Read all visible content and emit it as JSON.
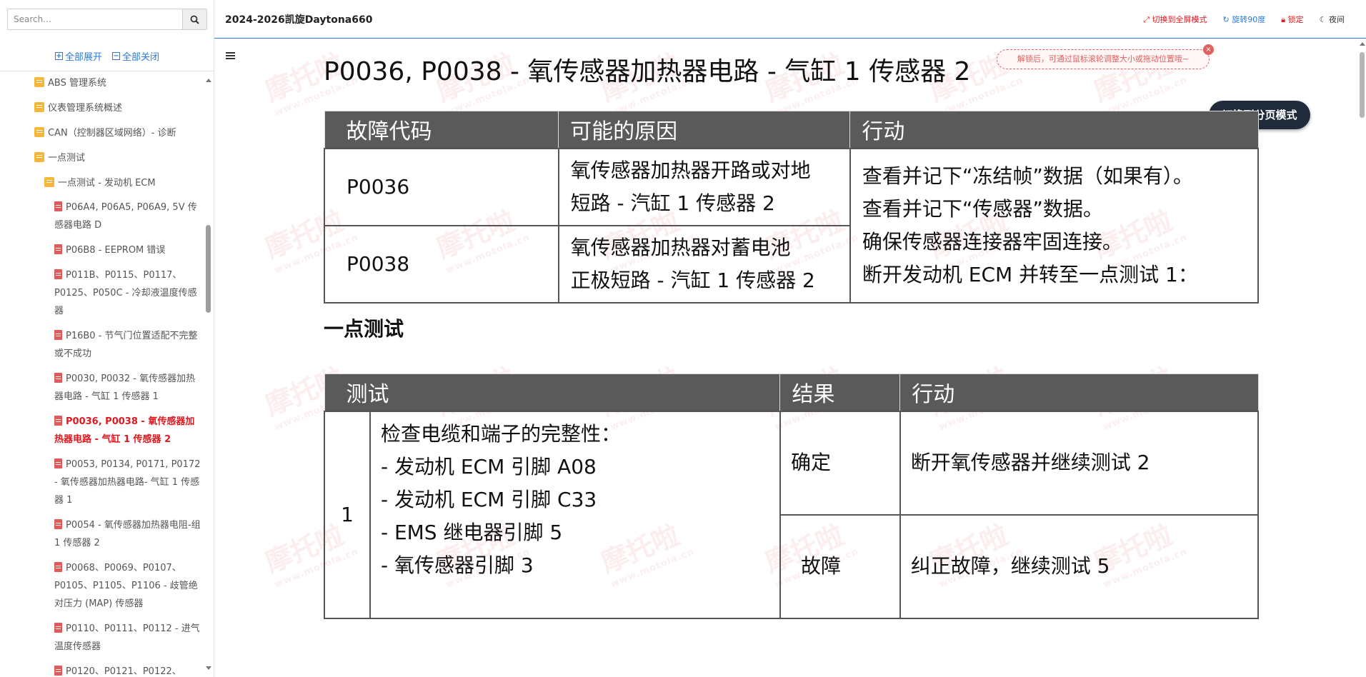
{
  "sidebar": {
    "search_placeholder": "Search...",
    "expand_all": "全部展开",
    "collapse_all": "全部关闭",
    "items": [
      {
        "label": "ABS 管理系统",
        "type": "folder"
      },
      {
        "label": "仪表管理系统概述",
        "type": "folder"
      },
      {
        "label": "CAN（控制器区域网络）- 诊断",
        "type": "folder"
      },
      {
        "label": "一点测试",
        "type": "folder"
      },
      {
        "label": "一点测试 - 发动机 ECM",
        "type": "folder"
      },
      {
        "label": "P06A4, P06A5, P06A9, 5V 传感器电路 D",
        "type": "doc"
      },
      {
        "label": "P06B8 - EEPROM 错误",
        "type": "doc"
      },
      {
        "label": "P011B、P0115、P0117、P0125、P050C - 冷却液温度传感器",
        "type": "doc"
      },
      {
        "label": "P16B0 - 节气门位置适配不完整或不成功",
        "type": "doc"
      },
      {
        "label": "P0030, P0032 - 氧传感器加热器电路 - 气缸 1 传感器 1",
        "type": "doc"
      },
      {
        "label": "P0036, P0038 - 氧传感器加热器电路 - 气缸 1 传感器 2",
        "type": "doc",
        "active": true
      },
      {
        "label": "P0053, P0134, P0171, P0172 - 氧传感器加热器电路- 气缸 1 传感器 1",
        "type": "doc"
      },
      {
        "label": "P0054 - 氧传感器加热器电阻-组 1 传感器 2",
        "type": "doc"
      },
      {
        "label": "P0068、P0069、P0107、P0105、P1105、P1106 - 歧管绝对压力 (MAP) 传感器",
        "type": "doc"
      },
      {
        "label": "P0110、P0111、P0112 - 进气温度传感器",
        "type": "doc"
      },
      {
        "label": "P0120、P0121、P0122、",
        "type": "doc"
      }
    ]
  },
  "topbar": {
    "title": "2024-2026凯旋Daytona660",
    "fullscreen": "切换到全屏模式",
    "rotate": "旋转90度",
    "lock": "锁定",
    "night": "夜间"
  },
  "content": {
    "heading": "P0036, P0038 - 氧传感器加热器电路 - 气缸 1 传感器 2",
    "hint": "解锁后，可通过鼠标滚轮调整大小或拖动位置哦~",
    "page_mode_button": "切换到分页模式",
    "watermark": "摩托啦",
    "watermark_url": "www.motola.cn",
    "table1": {
      "headers": [
        "故障代码",
        "可能的原因",
        "行动"
      ],
      "rows": [
        {
          "code": "P0036",
          "cause_l1": "氧传感器加热器开路或对地",
          "cause_l2": "短路 - 汽缸 1 传感器 2"
        },
        {
          "code": "P0038",
          "cause_l1": "氧传感器加热器对蓄电池",
          "cause_l2": "正极短路 - 汽缸 1 传感器 2"
        }
      ],
      "action_lines": [
        "查看并记下“冻结帧”数据（如果有）。",
        "查看并记下“传感器”数据。",
        "确保传感器连接器牢固连接。",
        "断开发动机 ECM 并转至一点测试 1："
      ]
    },
    "section_title": "一点测试",
    "table2": {
      "headers": [
        "测试",
        "结果",
        "行动"
      ],
      "test_num": "1",
      "test_lines": [
        "检查电缆和端子的完整性：",
        "- 发动机 ECM 引脚 A08",
        "- 发动机 ECM 引脚 C33",
        "- EMS 继电器引脚 5",
        "- 氧传感器引脚 3"
      ],
      "results": [
        {
          "result": "确定",
          "action": "断开氧传感器并继续测试 2"
        },
        {
          "result": "故障",
          "action": "纠正故障，继续测试 5"
        }
      ]
    }
  }
}
